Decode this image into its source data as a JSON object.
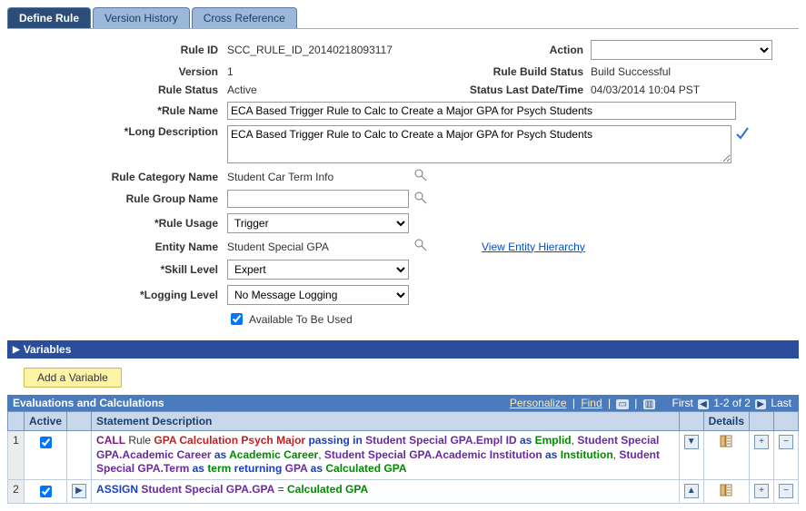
{
  "tabs": {
    "define": "Define Rule",
    "history": "Version History",
    "xref": "Cross Reference"
  },
  "labels": {
    "rule_id": "Rule ID",
    "version": "Version",
    "rule_status": "Rule Status",
    "rule_name": "*Rule Name",
    "long_desc": "*Long Description",
    "category": "Rule Category Name",
    "group": "Rule Group Name",
    "usage": "*Rule Usage",
    "entity": "Entity Name",
    "skill": "*Skill Level",
    "logging": "*Logging Level",
    "action": "Action",
    "build_status": "Rule Build Status",
    "status_dt": "Status Last Date/Time",
    "available": "Available To Be Used",
    "view_hierarchy": "View Entity Hierarchy"
  },
  "values": {
    "rule_id": "SCC_RULE_ID_20140218093117",
    "version": "1",
    "rule_status": "Active",
    "build_status": "Build Successful",
    "status_dt": "04/03/2014 10:04 PST",
    "rule_name": "ECA Based Trigger Rule to Calc to Create a Major GPA for Psych Students",
    "long_desc": "ECA Based Trigger Rule to Calc to Create a Major GPA for Psych Students",
    "category": "Student Car Term Info",
    "group": "",
    "usage": "Trigger",
    "entity": "Student Special GPA",
    "skill": "Expert",
    "logging": "No Message Logging",
    "available_checked": true
  },
  "variables_section": "Variables",
  "add_variable": "Add a Variable",
  "grid": {
    "title": "Evaluations and Calculations",
    "personalize": "Personalize",
    "find": "Find",
    "nav_first": "First",
    "nav_range": "1-2 of 2",
    "nav_last": "Last",
    "cols": {
      "active": "Active",
      "stmt": "Statement Description",
      "details": "Details"
    }
  },
  "rows": [
    {
      "n": "1",
      "stmt_parts": [
        {
          "t": "CALL",
          "c": "kw-call"
        },
        {
          "t": " Rule ",
          "c": ""
        },
        {
          "t": "GPA Calculation Psych Major",
          "c": "kw-red"
        },
        {
          "t": " passing in ",
          "c": "kw-blue"
        },
        {
          "t": "Student Special GPA.Empl ID",
          "c": "kw-purple"
        },
        {
          "t": " as ",
          "c": "kw-blue"
        },
        {
          "t": "Emplid",
          "c": "kw-green"
        },
        {
          "t": ", ",
          "c": ""
        },
        {
          "t": "Student Special GPA.Academic Career",
          "c": "kw-purple"
        },
        {
          "t": " as ",
          "c": "kw-blue"
        },
        {
          "t": "Academic Career",
          "c": "kw-green"
        },
        {
          "t": ", ",
          "c": ""
        },
        {
          "t": "Student Special GPA.Academic Institution",
          "c": "kw-purple"
        },
        {
          "t": " as ",
          "c": "kw-blue"
        },
        {
          "t": "Institution",
          "c": "kw-green"
        },
        {
          "t": ", ",
          "c": ""
        },
        {
          "t": "Student Special GPA.Term",
          "c": "kw-purple"
        },
        {
          "t": " as ",
          "c": "kw-blue"
        },
        {
          "t": "term",
          "c": "kw-green"
        },
        {
          "t": " returning ",
          "c": "kw-blue"
        },
        {
          "t": "GPA",
          "c": "kw-purple"
        },
        {
          "t": " as ",
          "c": "kw-blue"
        },
        {
          "t": "Calculated GPA",
          "c": "kw-green"
        }
      ],
      "arrow": "down"
    },
    {
      "n": "2",
      "stmt_parts": [
        {
          "t": "ASSIGN",
          "c": "kw-assign"
        },
        {
          "t": " ",
          "c": ""
        },
        {
          "t": "Student Special GPA.GPA",
          "c": "kw-purple"
        },
        {
          "t": " = ",
          "c": ""
        },
        {
          "t": "Calculated GPA",
          "c": "kw-green"
        }
      ],
      "arrow": "up"
    }
  ]
}
